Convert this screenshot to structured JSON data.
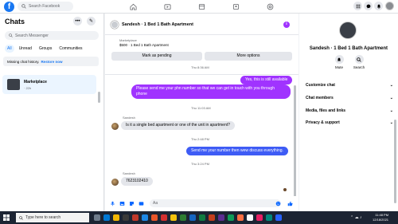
{
  "topbar": {
    "search_placeholder": "Search Facebook",
    "logo_letter": "f",
    "brand_color": "#1877f2",
    "nav_icons": [
      "home-icon",
      "video-icon",
      "marketplace-icon",
      "groups-icon",
      "gaming-icon"
    ],
    "right_icons": [
      "menu-grid-icon",
      "messenger-icon",
      "bell-icon",
      "avatar"
    ]
  },
  "left": {
    "title": "Chats",
    "more_label": "•••",
    "compose_label": "✎",
    "search_placeholder": "Search Messenger",
    "filters": [
      "All",
      "Unread",
      "Groups",
      "Communities"
    ],
    "missing_text": "Missing chat history.",
    "restore_label": "Restore now",
    "chats": [
      {
        "name": "Marketplace",
        "subtitle": "· 22h"
      }
    ]
  },
  "conversation": {
    "title": "Sandesh · 1 Bed 1 Bath Apartment",
    "info_label": "i",
    "marketplace_label": "Marketplace",
    "listing_price": "$500 · 1 Bed 1 Bath Apartment",
    "mark_pending_label": "Mark as pending",
    "more_options_label": "More options",
    "messages": [
      {
        "type": "time",
        "text": "Thu 8:36 AM"
      },
      {
        "type": "out",
        "text": "Yes, this is still available"
      },
      {
        "type": "out",
        "text": "Please send me your phn number so that we can get in touch with you through phone"
      },
      {
        "type": "time",
        "text": "Thu 11:03 AM"
      },
      {
        "type": "sender",
        "text": "Sandesh"
      },
      {
        "type": "in",
        "text": "Is it a single bed apartment or one of the unit in apartment?"
      },
      {
        "type": "time",
        "text": "Thu 2:48 PM"
      },
      {
        "type": "out",
        "text": "Send me your number then wew discuss everything."
      },
      {
        "type": "time",
        "text": "Thu 3:24 PM"
      },
      {
        "type": "sender",
        "text": "Sandesh"
      },
      {
        "type": "in",
        "text": "7623102410"
      }
    ],
    "composer_placeholder": "Aa",
    "composer_icons": [
      "mic-icon",
      "image-icon",
      "sticker-icon",
      "gif-icon",
      "emoji-icon",
      "like-icon"
    ],
    "accent_color": "#a033ff",
    "blue_bubble_color": "#3e5cf5"
  },
  "right_panel": {
    "name": "Sandesh · 1 Bed 1 Bath Apartment",
    "mute_label": "Mute",
    "search_label": "Search",
    "sections": [
      "Customize chat",
      "Chat members",
      "Media, files and links",
      "Privacy & support"
    ]
  },
  "taskbar": {
    "search_placeholder": "Type here to search",
    "time": "11:48 PM",
    "date": "12/18/2021"
  }
}
